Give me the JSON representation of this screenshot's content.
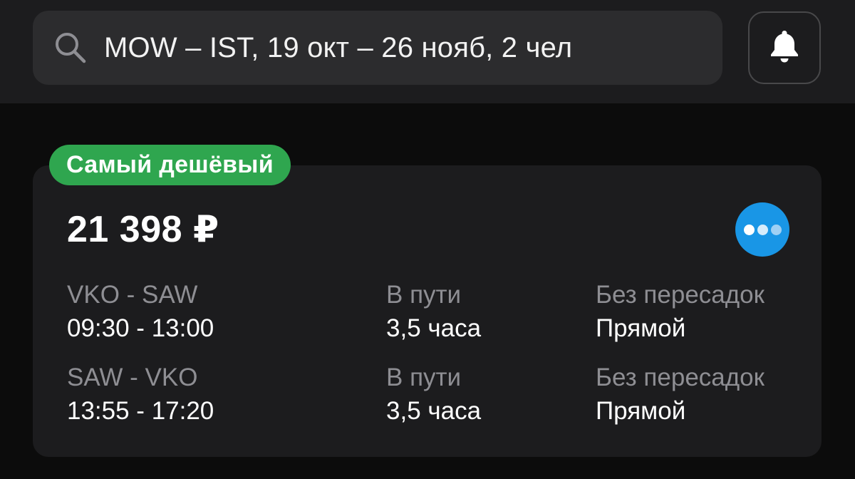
{
  "search": {
    "query": "MOW – IST, 19 окт – 26 нояб, 2 чел",
    "icon": "search-icon"
  },
  "header": {
    "bell_icon": "bell-icon"
  },
  "result": {
    "badge": "Самый дешёвый",
    "price": "21 398 ₽",
    "airline_logo_color": "#1996e6",
    "segments": [
      {
        "route": "VKO - SAW",
        "times": "09:30 - 13:00",
        "duration_label": "В пути",
        "duration": "3,5 часа",
        "stops_label": "Без пересадок",
        "stops": "Прямой"
      },
      {
        "route": "SAW - VKO",
        "times": "13:55 - 17:20",
        "duration_label": "В пути",
        "duration": "3,5 часа",
        "stops_label": "Без пересадок",
        "stops": "Прямой"
      }
    ]
  },
  "colors": {
    "background": "#0c0c0c",
    "header": "#1c1c1e",
    "search_bar": "#2c2c2e",
    "card": "#1c1c1e",
    "badge": "#2fa64f",
    "muted_text": "#8e8e93"
  }
}
